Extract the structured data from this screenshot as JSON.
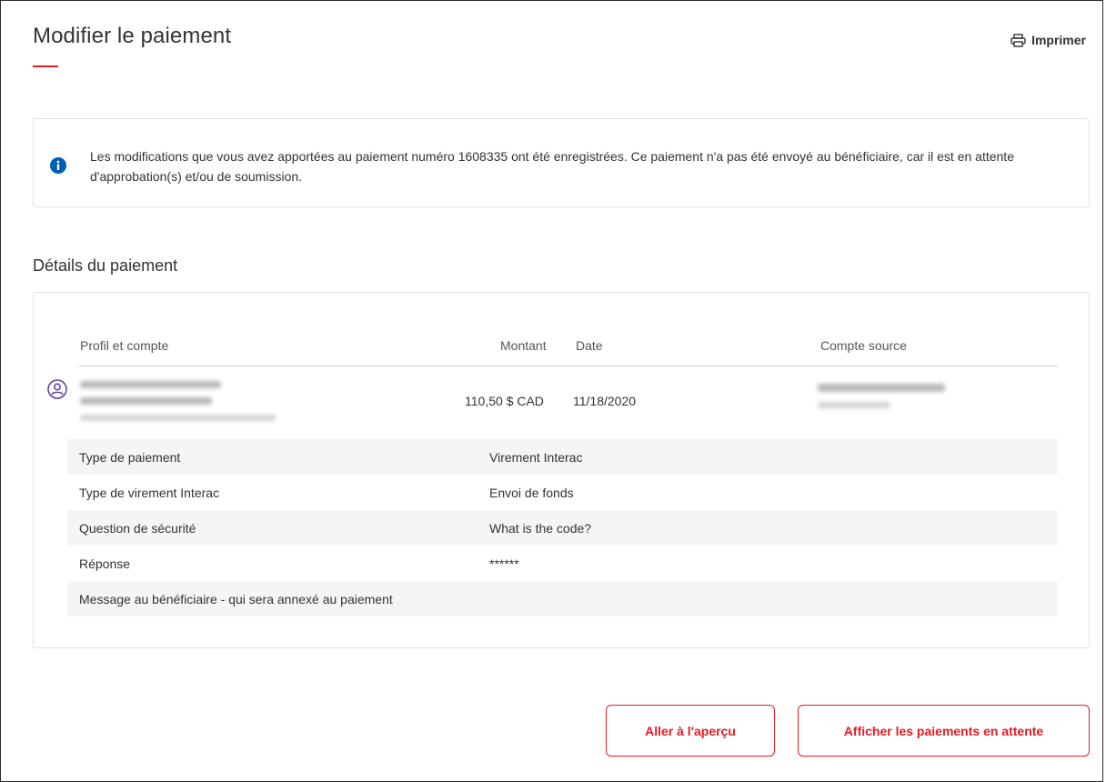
{
  "header": {
    "title": "Modifier le paiement",
    "print_label": "Imprimer"
  },
  "alert": {
    "message": "Les modifications que vous avez apportées au paiement numéro 1608335 ont été enregistrées. Ce paiement n'a pas été envoyé au bénéficiaire, car il est en attente d'approbation(s) et/ou de soumission.",
    "icon": "info-icon"
  },
  "details": {
    "section_title": "Détails du paiement",
    "columns": {
      "profile": "Profil et compte",
      "amount": "Montant",
      "date": "Date",
      "source": "Compte source"
    },
    "payment": {
      "amount": "110,50 $ CAD",
      "date": "11/18/2020"
    },
    "rows": [
      {
        "label": "Type de paiement",
        "value": "Virement Interac"
      },
      {
        "label": "Type de virement Interac",
        "value": "Envoi de fonds"
      },
      {
        "label": "Question de sécurité",
        "value": "What is the code?"
      },
      {
        "label": "Réponse",
        "value": "******"
      },
      {
        "label": "Message au bénéficiaire - qui sera annexé au paiement",
        "value": ""
      }
    ]
  },
  "actions": {
    "overview_label": "Aller à l'aperçu",
    "pending_label": "Afficher les paiements en attente"
  },
  "colors": {
    "accent": "#e31b23",
    "info": "#005eb8",
    "avatar": "#5b3a9a"
  }
}
